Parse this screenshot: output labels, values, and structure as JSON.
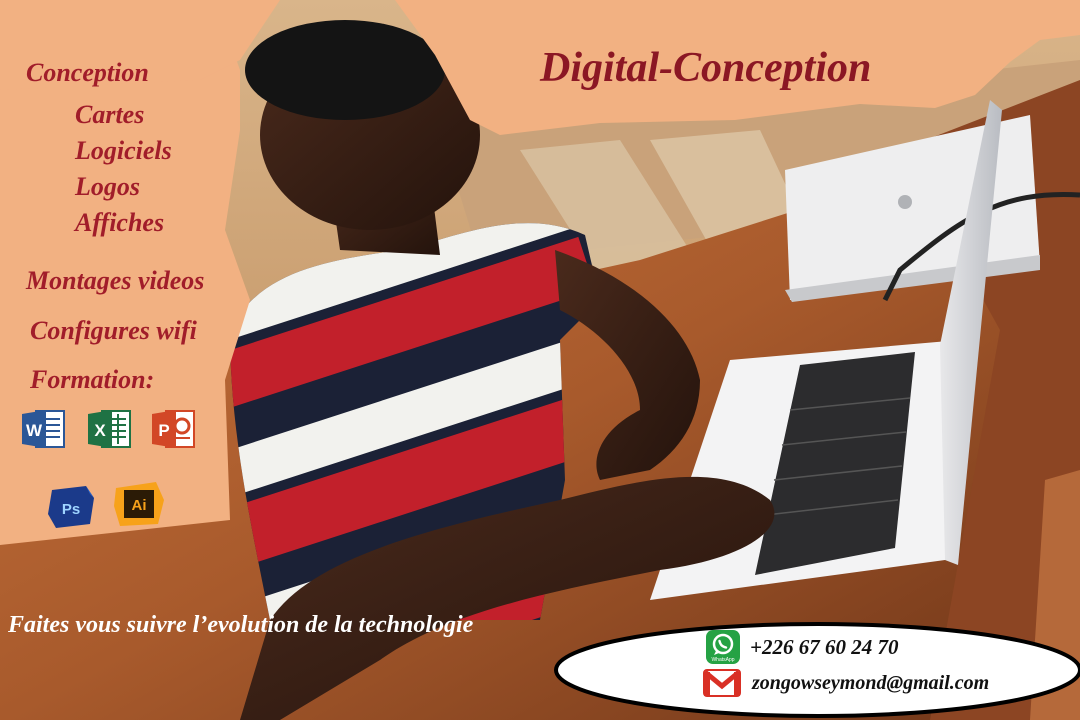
{
  "title": "Digital-Conception",
  "services": {
    "heading": "Conception",
    "sub_items": [
      "Cartes",
      "Logiciels",
      "Logos",
      "Affiches"
    ],
    "montages": "Montages videos",
    "wifi": "Configures wifi",
    "formation": "Formation:"
  },
  "apps": [
    {
      "icon": "word-icon",
      "letter": "W",
      "color": "#2b5797"
    },
    {
      "icon": "excel-icon",
      "letter": "X",
      "color": "#1f7244"
    },
    {
      "icon": "powerpoint-icon",
      "letter": "P",
      "color": "#d24726"
    },
    {
      "icon": "photoshop-icon",
      "letter": "Ps",
      "color": "#1b3a8a"
    },
    {
      "icon": "illustrator-icon",
      "letter": "Ai",
      "color": "#f7a21a"
    }
  ],
  "slogan": "Faites vous suivre l’evolution de la technologie",
  "contact": {
    "whatsapp_label": "WhatsApp",
    "phone": "+226 67 60 24 70",
    "email": "zongowseymond@gmail.com"
  },
  "colors": {
    "accent_red": "#a11d2a",
    "panel_peach": "#f2b182"
  }
}
